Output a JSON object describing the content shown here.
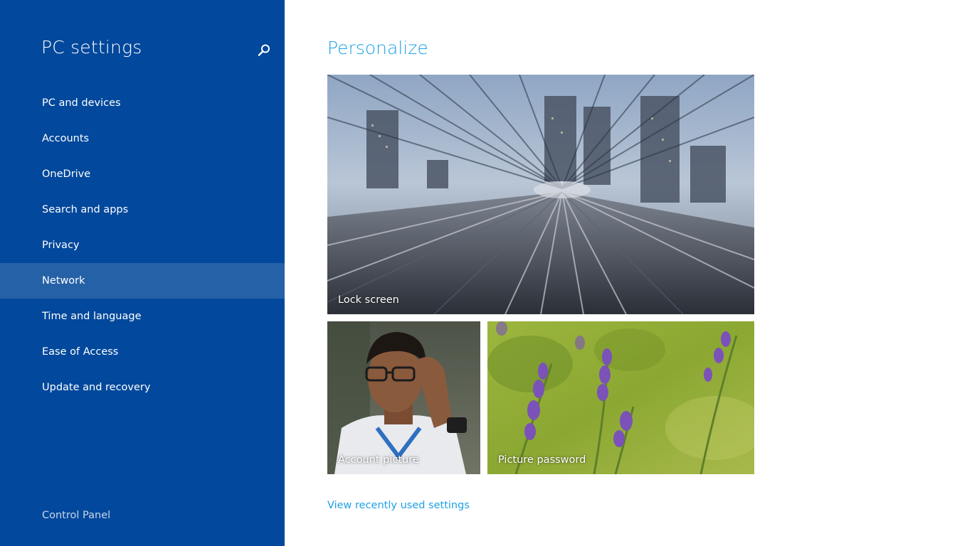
{
  "sidebar": {
    "title": "PC settings",
    "search_icon": "search-icon",
    "items": [
      {
        "label": "PC and devices",
        "selected": false
      },
      {
        "label": "Accounts",
        "selected": false
      },
      {
        "label": "OneDrive",
        "selected": false
      },
      {
        "label": "Search and apps",
        "selected": false
      },
      {
        "label": "Privacy",
        "selected": false
      },
      {
        "label": "Network",
        "selected": true
      },
      {
        "label": "Time and language",
        "selected": false
      },
      {
        "label": "Ease of Access",
        "selected": false
      },
      {
        "label": "Update and recovery",
        "selected": false
      }
    ],
    "footer_link": "Control Panel"
  },
  "main": {
    "title": "Personalize",
    "tiles": {
      "lock_screen": "Lock screen",
      "account_picture": "Account picture",
      "picture_password": "Picture password"
    },
    "recent_link": "View recently used settings"
  },
  "colors": {
    "sidebar_bg": "#02489c",
    "sidebar_selected_bg": "#2561a6",
    "accent": "#1ea1e6"
  }
}
